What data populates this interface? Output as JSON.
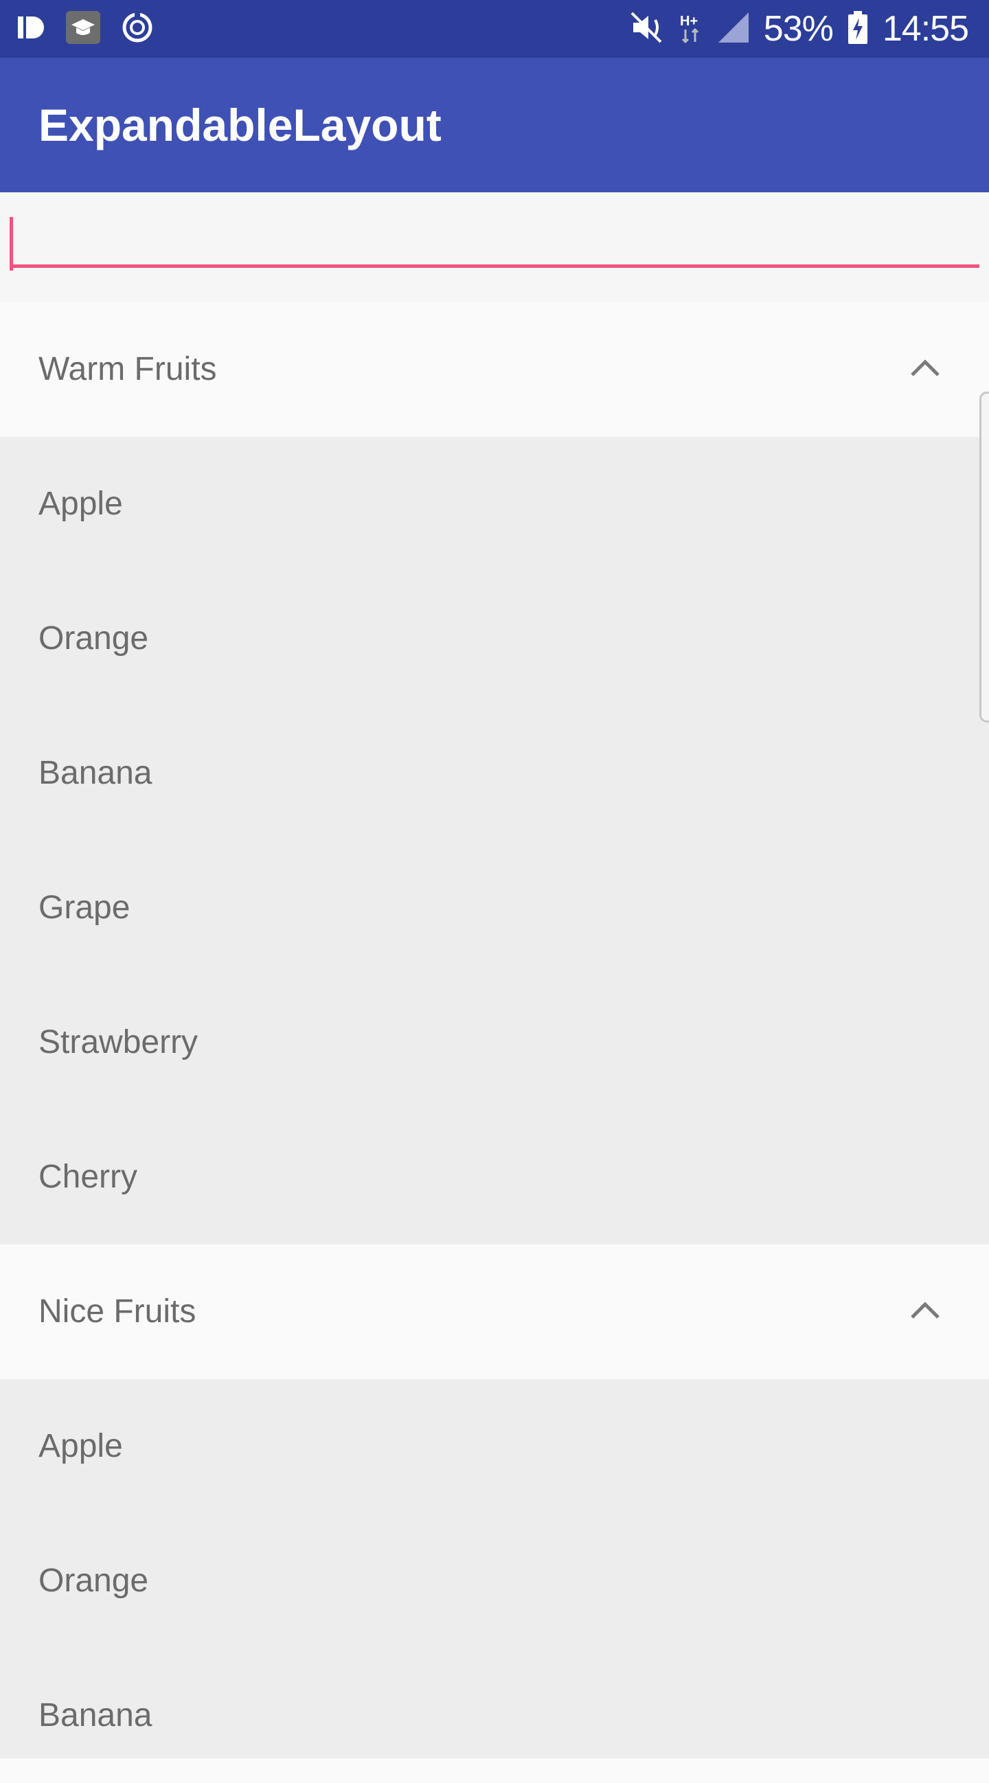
{
  "status_bar": {
    "battery_percent": "53%",
    "time": "14:55",
    "icons": [
      "id-icon",
      "graduation-cap-icon",
      "sync-icon",
      "mute-vibrate-icon",
      "network-h-plus-icon",
      "signal-icon",
      "battery-charging-icon"
    ]
  },
  "app_bar": {
    "title": "ExpandableLayout"
  },
  "search": {
    "value": "",
    "accent_color": "#f0537d"
  },
  "sections": [
    {
      "title": "Warm Fruits",
      "expanded": true,
      "items": [
        "Apple",
        "Orange",
        "Banana",
        "Grape",
        "Strawberry",
        "Cherry"
      ]
    },
    {
      "title": "Nice Fruits",
      "expanded": true,
      "items": [
        "Apple",
        "Orange",
        "Banana"
      ]
    }
  ],
  "colors": {
    "primary": "#3f51b5",
    "primary_dark": "#2c3e9a",
    "accent": "#f0537d"
  }
}
